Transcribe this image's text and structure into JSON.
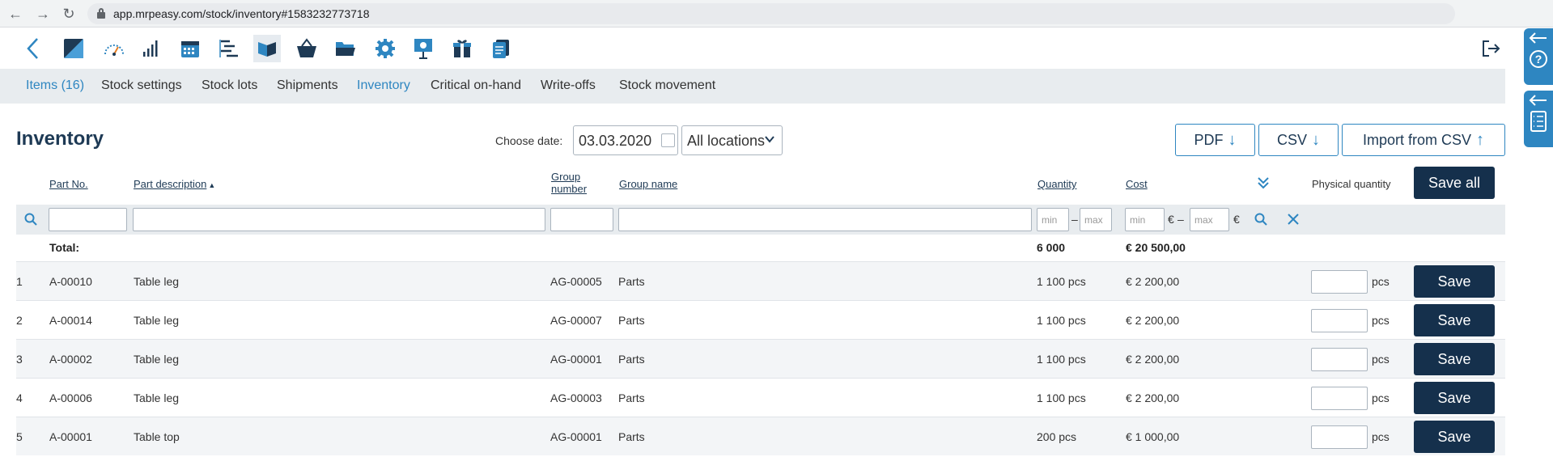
{
  "browser": {
    "url": "app.mrpeasy.com/stock/inventory#1583232773718"
  },
  "subnav": {
    "items": [
      {
        "label": "Items (16)"
      },
      {
        "label": "Stock settings"
      },
      {
        "label": "Stock lots"
      },
      {
        "label": "Shipments"
      },
      {
        "label": "Inventory"
      },
      {
        "label": "Critical on-hand"
      },
      {
        "label": "Write-offs"
      },
      {
        "label": "Stock movement"
      }
    ]
  },
  "header": {
    "title": "Inventory",
    "choose_date_label": "Choose date:",
    "date_value": "03.03.2020",
    "location_value": "All locations",
    "pdf_label": "PDF",
    "csv_label": "CSV",
    "import_label": "Import from CSV"
  },
  "columns": {
    "part_no": "Part No.",
    "part_description": "Part description",
    "group_number_1": "Group",
    "group_number_2": "number",
    "group_name": "Group name",
    "quantity": "Quantity",
    "cost": "Cost",
    "physical_quantity": "Physical quantity",
    "save_all": "Save all"
  },
  "filters": {
    "min_placeholder": "min",
    "max_placeholder": "max",
    "dash": "–",
    "euro": "€"
  },
  "total": {
    "label": "Total:",
    "quantity": "6 000",
    "cost": "€ 20 500,00"
  },
  "rows": [
    {
      "num": "1",
      "part_no": "A-00010",
      "desc": "Table leg",
      "group_number": "AG-00005",
      "group_name": "Parts",
      "quantity": "1 100 pcs",
      "cost": "€ 2 200,00",
      "unit": "pcs",
      "save": "Save"
    },
    {
      "num": "2",
      "part_no": "A-00014",
      "desc": "Table leg",
      "group_number": "AG-00007",
      "group_name": "Parts",
      "quantity": "1 100 pcs",
      "cost": "€ 2 200,00",
      "unit": "pcs",
      "save": "Save"
    },
    {
      "num": "3",
      "part_no": "A-00002",
      "desc": "Table leg",
      "group_number": "AG-00001",
      "group_name": "Parts",
      "quantity": "1 100 pcs",
      "cost": "€ 2 200,00",
      "unit": "pcs",
      "save": "Save"
    },
    {
      "num": "4",
      "part_no": "A-00006",
      "desc": "Table leg",
      "group_number": "AG-00003",
      "group_name": "Parts",
      "quantity": "1 100 pcs",
      "cost": "€ 2 200,00",
      "unit": "pcs",
      "save": "Save"
    },
    {
      "num": "5",
      "part_no": "A-00001",
      "desc": "Table top",
      "group_number": "AG-00001",
      "group_name": "Parts",
      "quantity": "200 pcs",
      "cost": "€ 1 000,00",
      "unit": "pcs",
      "save": "Save"
    }
  ],
  "icons": {
    "toolbar": [
      "back-icon",
      "logo-icon",
      "dashboard-icon",
      "statistics-icon",
      "calendar-icon",
      "production-icon",
      "stock-icon",
      "procurement-icon",
      "crm-icon",
      "settings-icon",
      "presentation-icon",
      "gift-icon",
      "documents-icon",
      "logout-icon"
    ]
  },
  "colors": {
    "accent": "#2e86c1",
    "dark_button": "#15304c",
    "title": "#1e3a55",
    "subnav_bg": "#e8ecef"
  }
}
